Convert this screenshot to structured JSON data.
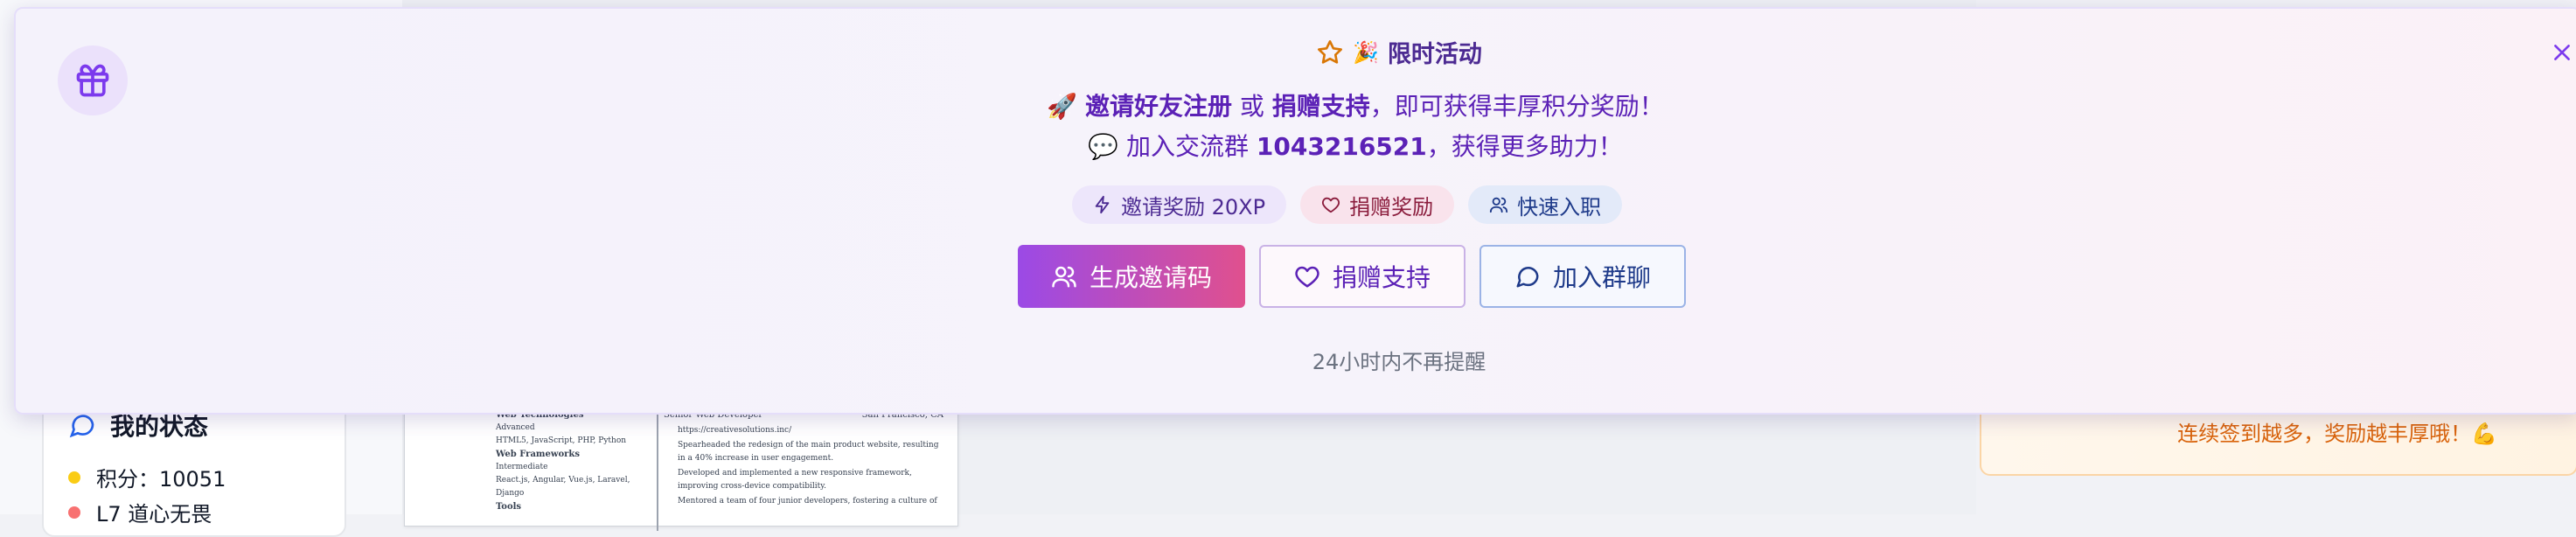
{
  "banner": {
    "title": "限时活动",
    "title_emoji": "🎉",
    "line1": {
      "emoji": "🚀",
      "invite": "邀请好友注册",
      "or": " 或 ",
      "donate": "捐赠支持",
      "suffix": "，即可获得丰厚积分奖励！"
    },
    "line2": {
      "emoji": "💬",
      "prefix": "加入交流群 ",
      "group": "1043216521",
      "suffix": "，获得更多助力！"
    },
    "badges": [
      {
        "icon": "lightning-icon",
        "label": "邀请奖励 20XP"
      },
      {
        "icon": "heart-icon",
        "label": "捐赠奖励"
      },
      {
        "icon": "users-icon",
        "label": "快速入职"
      }
    ],
    "buttons": {
      "generate": "生成邀请码",
      "donate": "捐赠支持",
      "join": "加入群聊"
    },
    "dismiss": "24小时内不再提醒",
    "colors": {
      "accent": "#5b21b6",
      "gradient_start": "#9b4ae6",
      "gradient_end": "#e0508e"
    }
  },
  "sidebar": {
    "status_title": "我的状态",
    "points": "积分：10051",
    "level": "L7 道心无畏"
  },
  "resume": {
    "left": {
      "section1": "Web Technologies",
      "level1": "Advanced",
      "items1": "HTML5, JavaScript, PHP, Python",
      "section2": "Web Frameworks",
      "level2": "Intermediate",
      "items2": "React.js, Angular, Vue.js, Laravel, Django",
      "section3": "Tools"
    },
    "right": {
      "role": "Senior Web Developer",
      "location": "San Francisco, CA",
      "link": "https://creativesolutions.inc/",
      "bullet1": "Spearheaded the redesign of the main product website, resulting in a 40% increase in user engagement.",
      "bullet2": "Developed and implemented a new responsive framework, improving cross-device compatibility.",
      "bullet3": "Mentored a team of four junior developers, fostering a culture of"
    }
  },
  "tip": {
    "text": "连续签到越多，奖励越丰厚哦！💪"
  }
}
